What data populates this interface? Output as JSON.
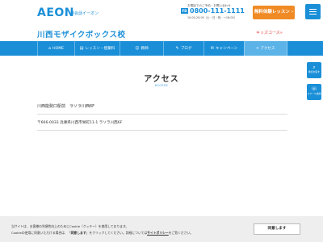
{
  "header": {
    "logo": "AEON",
    "logo_sub": "英会話イーオン",
    "phone_note": "お電話でのご予約・お問い合わせ",
    "phone_badge": "FD",
    "phone": "0800-111-1111",
    "phone_hours": "10:00-20:00（土・日・祝：～18:00）",
    "trial_label": "無料体験レッスン ›"
  },
  "school": {
    "title": "川西モザイクボックス校",
    "kids_link": "キッズコース",
    "kids_arrow": "»"
  },
  "nav": {
    "items": [
      {
        "icon": "⌂",
        "label": "HOME"
      },
      {
        "icon": "▤",
        "label": "レッスン・授業料"
      },
      {
        "icon": "☺",
        "label": "教師"
      },
      {
        "icon": "✎",
        "label": "ブログ"
      },
      {
        "icon": "✉",
        "label": "キャンペーン"
      },
      {
        "icon": "⌖",
        "label": "アクセス"
      }
    ]
  },
  "page": {
    "heading": "アクセス",
    "sub": "ACCESS"
  },
  "side": {
    "fab1_glyph": "⌕",
    "fab1_label": "教室を探す",
    "fab2_glyph": "☏",
    "fab2_label": "スクール連絡"
  },
  "info": {
    "school_name": "川西能勢口駅前　ラソラ川西6F",
    "address": "〒666-0033 兵庫県川西市栄町11-1 ラソラ川西6F"
  },
  "cookie": {
    "line1": "当サイトは、お客様の利便性向上のためにCookie（クッキー）を使用しております。",
    "line2_a": "Cookieの使用に同意いただける場合は、「",
    "line2_b": "同意します",
    "line2_c": "」をクリックしてください。詳細については",
    "policy_link": "サイトポリシー",
    "line2_d": "をご覧ください。",
    "agree_label": "同意します"
  },
  "colors": {
    "brand": "#1a8fd8",
    "accent": "#f08a24",
    "kids": "#e8433c"
  }
}
